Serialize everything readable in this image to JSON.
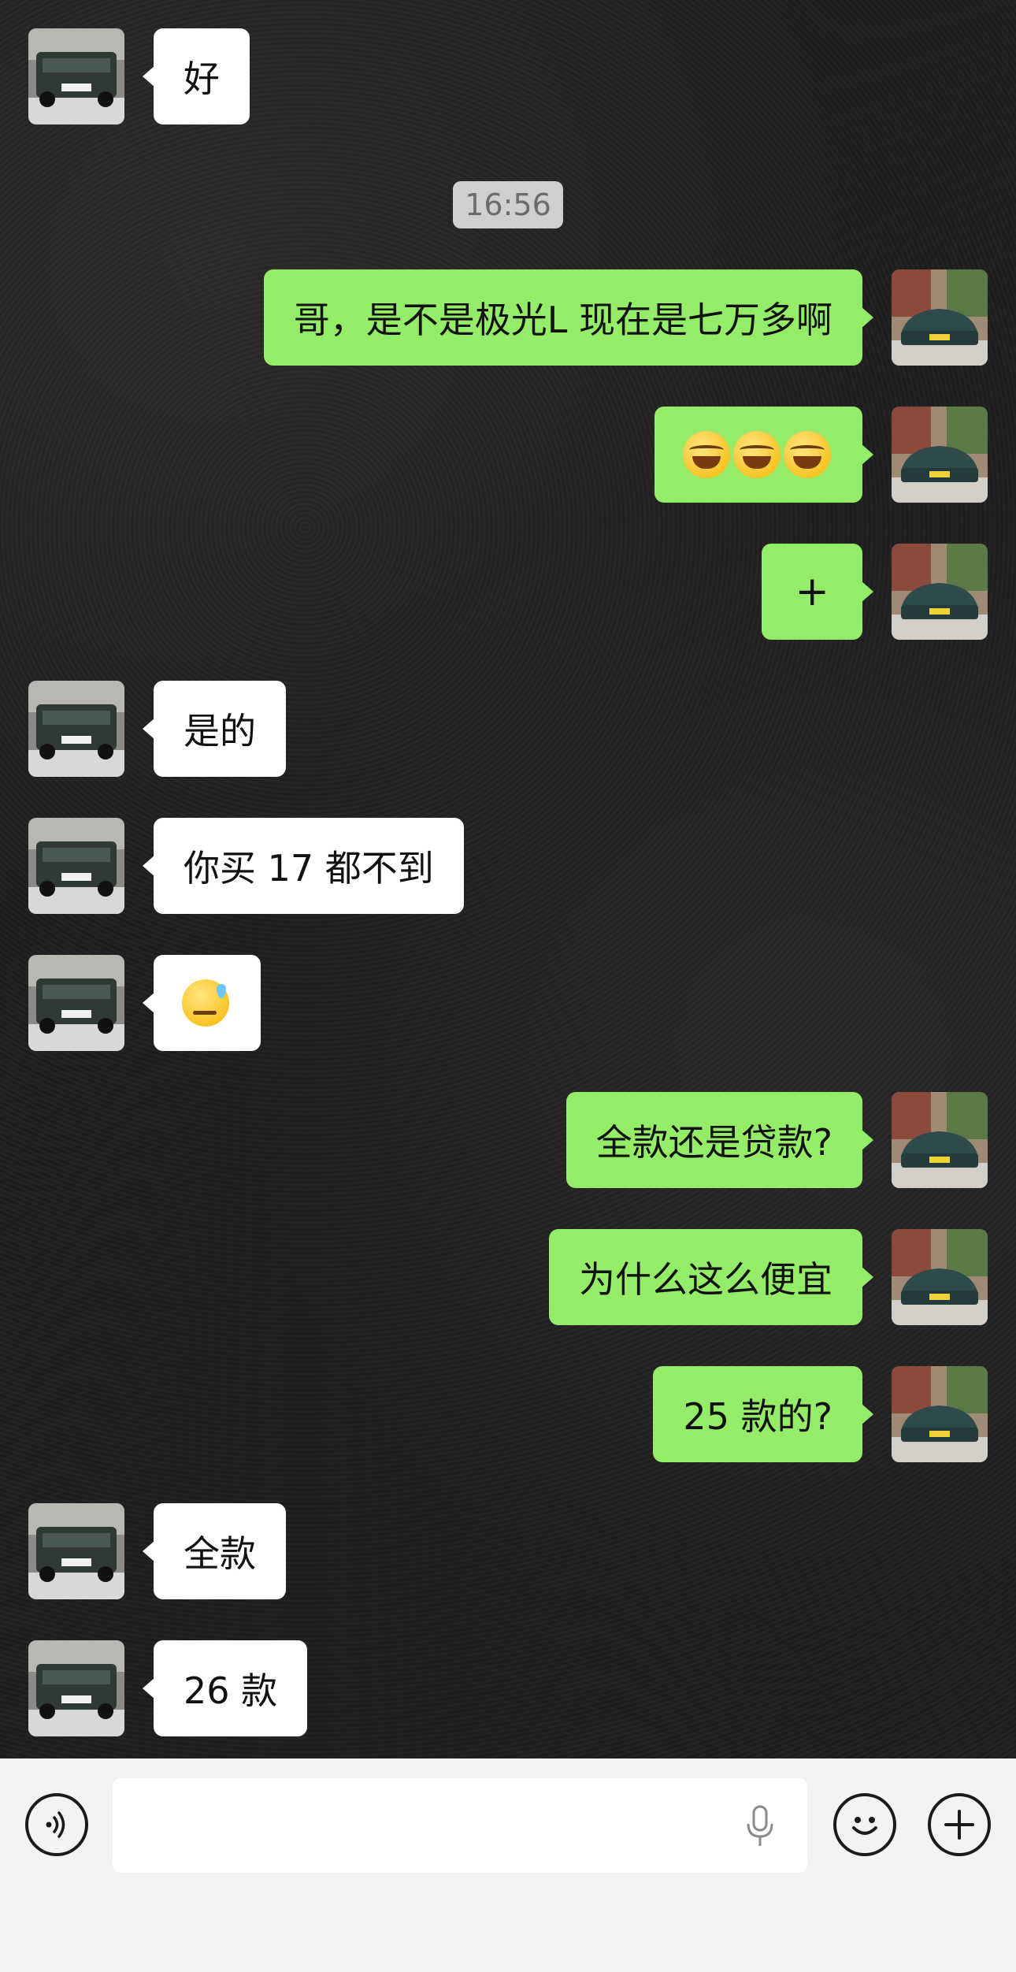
{
  "timestamp": "16:56",
  "messages": [
    {
      "side": "in",
      "type": "text",
      "text": "好"
    },
    {
      "side": "out",
      "type": "text",
      "text": "哥，是不是极光L 现在是七万多啊"
    },
    {
      "side": "out",
      "type": "emoji",
      "emoji": "laugh-tears-x3"
    },
    {
      "side": "out",
      "type": "text",
      "text": "+"
    },
    {
      "side": "in",
      "type": "text",
      "text": "是的"
    },
    {
      "side": "in",
      "type": "text",
      "text": "你买 17 都不到"
    },
    {
      "side": "in",
      "type": "emoji",
      "emoji": "sweat-face"
    },
    {
      "side": "out",
      "type": "text",
      "text": "全款还是贷款?"
    },
    {
      "side": "out",
      "type": "text",
      "text": "为什么这么便宜"
    },
    {
      "side": "out",
      "type": "text",
      "text": "25 款的?"
    },
    {
      "side": "in",
      "type": "text",
      "text": "全款"
    },
    {
      "side": "in",
      "type": "text",
      "text": "26 款"
    }
  ],
  "input_bar": {
    "voice_icon": "voice-icon",
    "mic_icon": "microphone-icon",
    "emoji_icon": "smiley-icon",
    "plus_icon": "plus-icon"
  },
  "colors": {
    "incoming_bubble": "#ffffff",
    "outgoing_bubble": "#95ec69"
  }
}
